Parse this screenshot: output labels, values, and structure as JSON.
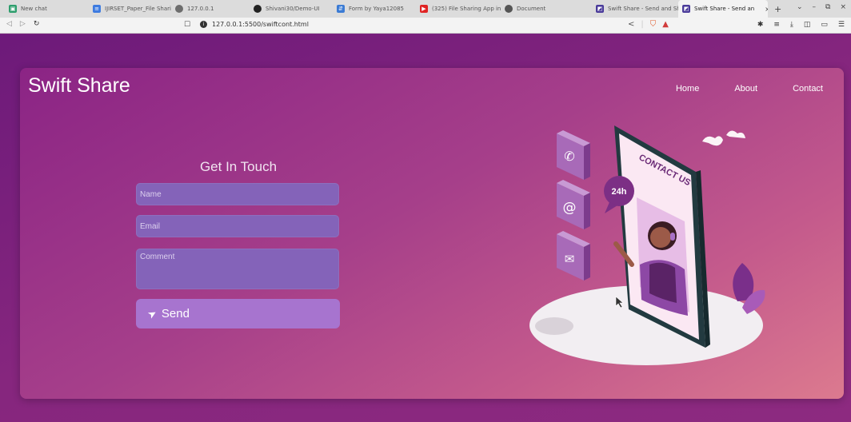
{
  "browser": {
    "tabs": [
      {
        "label": "New chat",
        "color": "#2e9e6d"
      },
      {
        "label": "IJIRSET_Paper_File Sharin",
        "color": "#3d7be0"
      },
      {
        "label": "127.0.0.1",
        "color": "#6d6d6d"
      },
      {
        "label": "Shivani30/Demo-UI",
        "color": "#222222"
      },
      {
        "label": "Form by Yaya12085",
        "color": "#3b7bd4"
      },
      {
        "label": "(325) File Sharing App in",
        "color": "#e02424"
      },
      {
        "label": "Document",
        "color": "#555555"
      },
      {
        "label": "Swift Share - Send and Sh",
        "color": "#4a3b9a"
      },
      {
        "label": "Swift Share - Send an",
        "color": "#4a3b9a"
      }
    ],
    "url": "127.0.0.1:5500/swiftcont.html",
    "new_tab": "+"
  },
  "site": {
    "brand": "Swift Share",
    "nav": [
      "Home",
      "About",
      "Contact"
    ]
  },
  "form": {
    "title": "Get In Touch",
    "name_placeholder": "Name",
    "email_placeholder": "Email",
    "comment_placeholder": "Comment",
    "send_label": "Send"
  },
  "illustration": {
    "screen_text": "CONTACT US",
    "badge_text": "24h",
    "icons": [
      "phone-icon",
      "at-icon",
      "envelope-icon"
    ]
  },
  "colors": {
    "field_bg": "#8463b9",
    "button_bg": "#a774cf",
    "card_start": "#8b2485",
    "card_end": "#dc7a8f"
  }
}
